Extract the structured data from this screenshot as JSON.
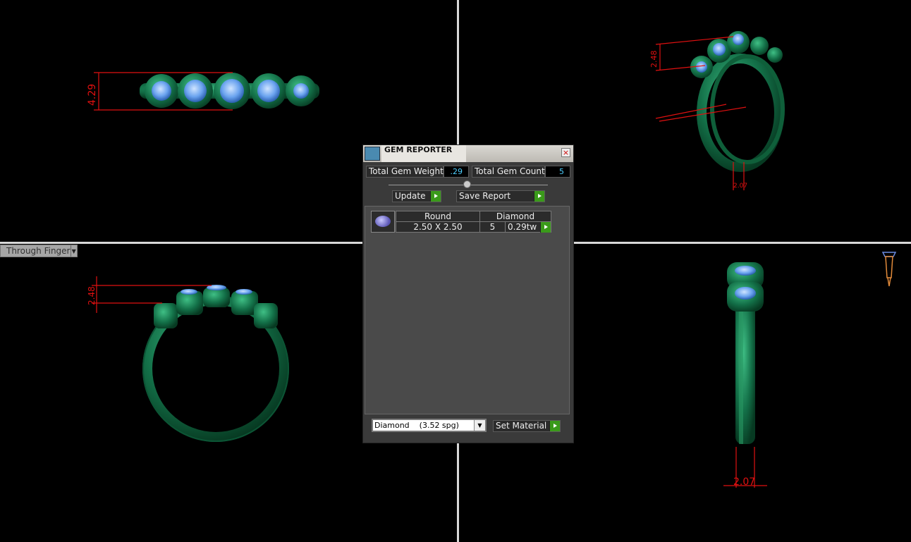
{
  "viewport": {
    "view_select_label": "Through Finger"
  },
  "dimensions": {
    "top_left_height": "4.29",
    "top_right_height": "2.48",
    "top_right_width": "2.07",
    "bottom_left_height": "2.48",
    "bottom_right_width": "2.07"
  },
  "colors": {
    "metal": "#1a7a4a",
    "gem": "#7ab4f5",
    "dimension": "#e01010",
    "background": "#000000"
  },
  "gem_reporter": {
    "title": "GEM REPORTER",
    "total_gem_weight_label": "Total Gem Weight",
    "total_gem_weight_value": ".29",
    "total_gem_count_label": "Total Gem Count",
    "total_gem_count_value": "5",
    "update_label": "Update",
    "save_report_label": "Save Report",
    "table": {
      "headers": [
        "Round",
        "Diamond"
      ],
      "rows": [
        {
          "size": "2.50 X 2.50",
          "count": "5",
          "weight": "0.29tw"
        }
      ]
    },
    "material_select": "Diamond    (3.52 spg)",
    "set_material_label": "Set Material"
  }
}
